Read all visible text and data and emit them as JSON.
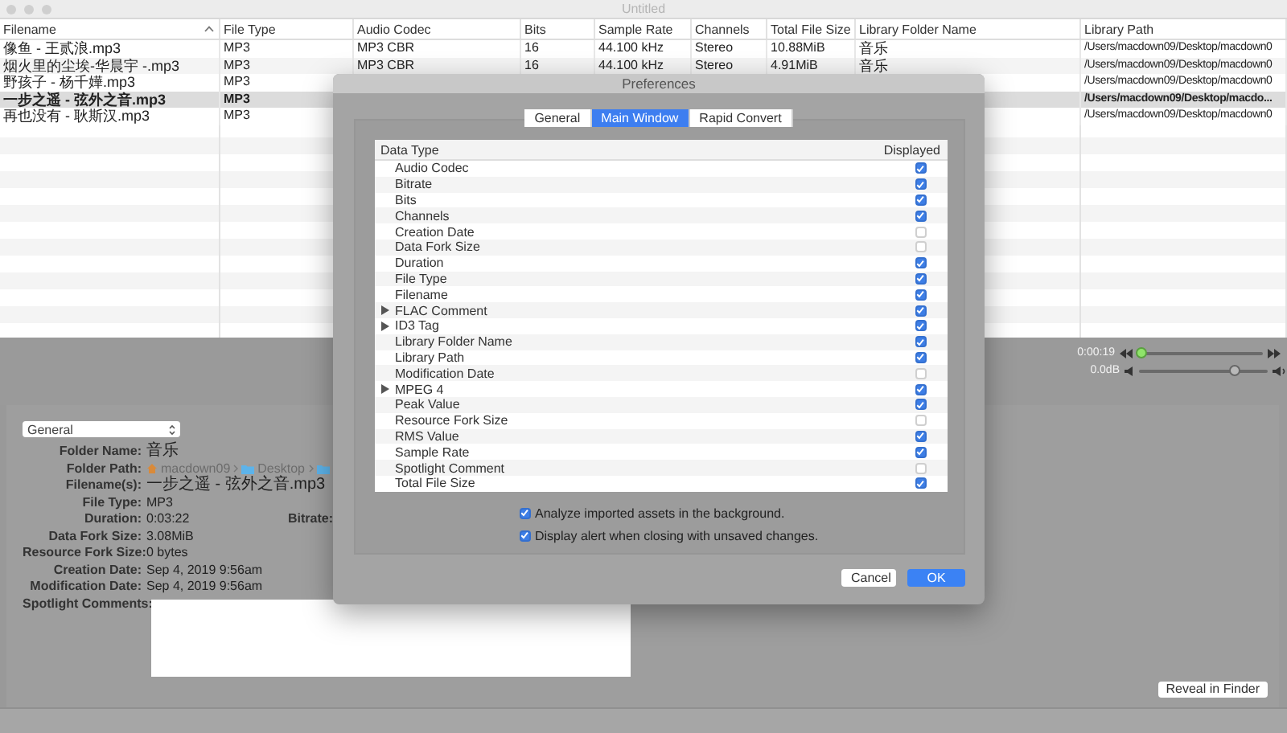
{
  "window": {
    "title": "Untitled"
  },
  "table": {
    "columns": [
      {
        "label": "Filename",
        "sorted": true
      },
      {
        "label": "File Type",
        "sorted": false
      },
      {
        "label": "Audio Codec",
        "sorted": false
      },
      {
        "label": "Bits",
        "sorted": false
      },
      {
        "label": "Sample Rate",
        "sorted": false
      },
      {
        "label": "Channels",
        "sorted": false
      },
      {
        "label": "Total File Size",
        "sorted": false
      },
      {
        "label": "Library Folder Name",
        "sorted": false
      },
      {
        "label": "Library Path",
        "sorted": false
      }
    ],
    "rows": [
      {
        "selected": false,
        "filename": "像鱼 - 王贰浪.mp3",
        "file_type": "MP3",
        "audio_codec": "MP3 CBR",
        "bits": "16",
        "sample_rate": "44.100 kHz",
        "channels": "Stereo",
        "total_file_size": "10.88MiB",
        "library_folder_name": "音乐",
        "library_path": "/Users/macdown09/Desktop/macdown0"
      },
      {
        "selected": false,
        "filename": "烟火里的尘埃-华晨宇 -.mp3",
        "file_type": "MP3",
        "audio_codec": "MP3 CBR",
        "bits": "16",
        "sample_rate": "44.100 kHz",
        "channels": "Stereo",
        "total_file_size": "4.91MiB",
        "library_folder_name": "音乐",
        "library_path": "/Users/macdown09/Desktop/macdown0"
      },
      {
        "selected": false,
        "filename": "野孩子 - 杨千嬅.mp3",
        "file_type": "MP3",
        "library_path": "/Users/macdown09/Desktop/macdown0"
      },
      {
        "selected": true,
        "filename": "一步之遥 - 弦外之音.mp3",
        "file_type": "MP3",
        "library_path": "/Users/macdown09/Desktop/macdo..."
      },
      {
        "selected": false,
        "filename": "再也没有 - 耿斯汉.mp3",
        "file_type": "MP3",
        "library_path": "/Users/macdown09/Desktop/macdown0"
      }
    ]
  },
  "player": {
    "position": {
      "time": "0:00:19",
      "level": 0.03
    },
    "volume": {
      "reading": "0.0dB",
      "level": 0.74
    }
  },
  "info": {
    "view_menu": {
      "value": "General"
    },
    "fields": [
      {
        "label": "Folder Name:",
        "kind": "text",
        "value": "音乐"
      },
      {
        "label": "Folder Path:",
        "kind": "path",
        "segments": [
          {
            "kind": "home",
            "text": "macdown09"
          },
          {
            "kind": "folder",
            "text": "Desktop"
          },
          {
            "kind": "folder"
          }
        ]
      },
      {
        "label": "Filename(s):",
        "kind": "text",
        "value": "一步之遥 - 弦外之音.mp3"
      },
      {
        "label": "File Type:",
        "kind": "text",
        "value": "MP3"
      },
      {
        "label": "Duration:",
        "kind": "text",
        "value": "0:03:22",
        "extra_label": "Bitrate:"
      },
      {
        "label": "Data Fork Size:",
        "kind": "text",
        "value": "3.08MiB"
      },
      {
        "label": "Resource Fork Size:",
        "kind": "text",
        "value": "0 bytes"
      },
      {
        "label": "Creation Date:",
        "kind": "text",
        "value": "Sep 4, 2019 9:56am"
      },
      {
        "label": "Modification Date:",
        "kind": "text",
        "value": "Sep 4, 2019 9:56am"
      }
    ],
    "spotlight_comments": {
      "label": "Spotlight Comments:"
    },
    "reveal_button": "Reveal in Finder"
  },
  "dialog": {
    "title": "Preferences",
    "tabs": [
      {
        "label": "General",
        "selected": false
      },
      {
        "label": "Main Window",
        "selected": true
      },
      {
        "label": "Rapid Convert",
        "selected": false
      }
    ],
    "columns": [
      "Data Type",
      "Displayed"
    ],
    "items": [
      {
        "label": "Audio Codec",
        "expandable": false,
        "displayed": true
      },
      {
        "label": "Bitrate",
        "expandable": false,
        "displayed": true
      },
      {
        "label": "Bits",
        "expandable": false,
        "displayed": true
      },
      {
        "label": "Channels",
        "expandable": false,
        "displayed": true
      },
      {
        "label": "Creation Date",
        "expandable": false,
        "displayed": false
      },
      {
        "label": "Data Fork Size",
        "expandable": false,
        "displayed": false
      },
      {
        "label": "Duration",
        "expandable": false,
        "displayed": true
      },
      {
        "label": "File Type",
        "expandable": false,
        "displayed": true
      },
      {
        "label": "Filename",
        "expandable": false,
        "displayed": true
      },
      {
        "label": "FLAC Comment",
        "expandable": true,
        "displayed": true
      },
      {
        "label": "ID3 Tag",
        "expandable": true,
        "displayed": true
      },
      {
        "label": "Library Folder Name",
        "expandable": false,
        "displayed": true
      },
      {
        "label": "Library Path",
        "expandable": false,
        "displayed": true
      },
      {
        "label": "Modification Date",
        "expandable": false,
        "displayed": false
      },
      {
        "label": "MPEG 4",
        "expandable": true,
        "displayed": true
      },
      {
        "label": "Peak Value",
        "expandable": false,
        "displayed": true
      },
      {
        "label": "Resource Fork Size",
        "expandable": false,
        "displayed": false
      },
      {
        "label": "RMS Value",
        "expandable": false,
        "displayed": true
      },
      {
        "label": "Sample Rate",
        "expandable": false,
        "displayed": true
      },
      {
        "label": "Spotlight Comment",
        "expandable": false,
        "displayed": false
      },
      {
        "label": "Total File Size",
        "expandable": false,
        "displayed": true
      }
    ],
    "options": [
      {
        "label": "Analyze imported assets in the background.",
        "checked": true
      },
      {
        "label": "Display alert when closing with unsaved changes.",
        "checked": true
      }
    ],
    "buttons": [
      {
        "label": "Cancel",
        "default": false
      },
      {
        "label": "OK",
        "default": true
      }
    ]
  }
}
